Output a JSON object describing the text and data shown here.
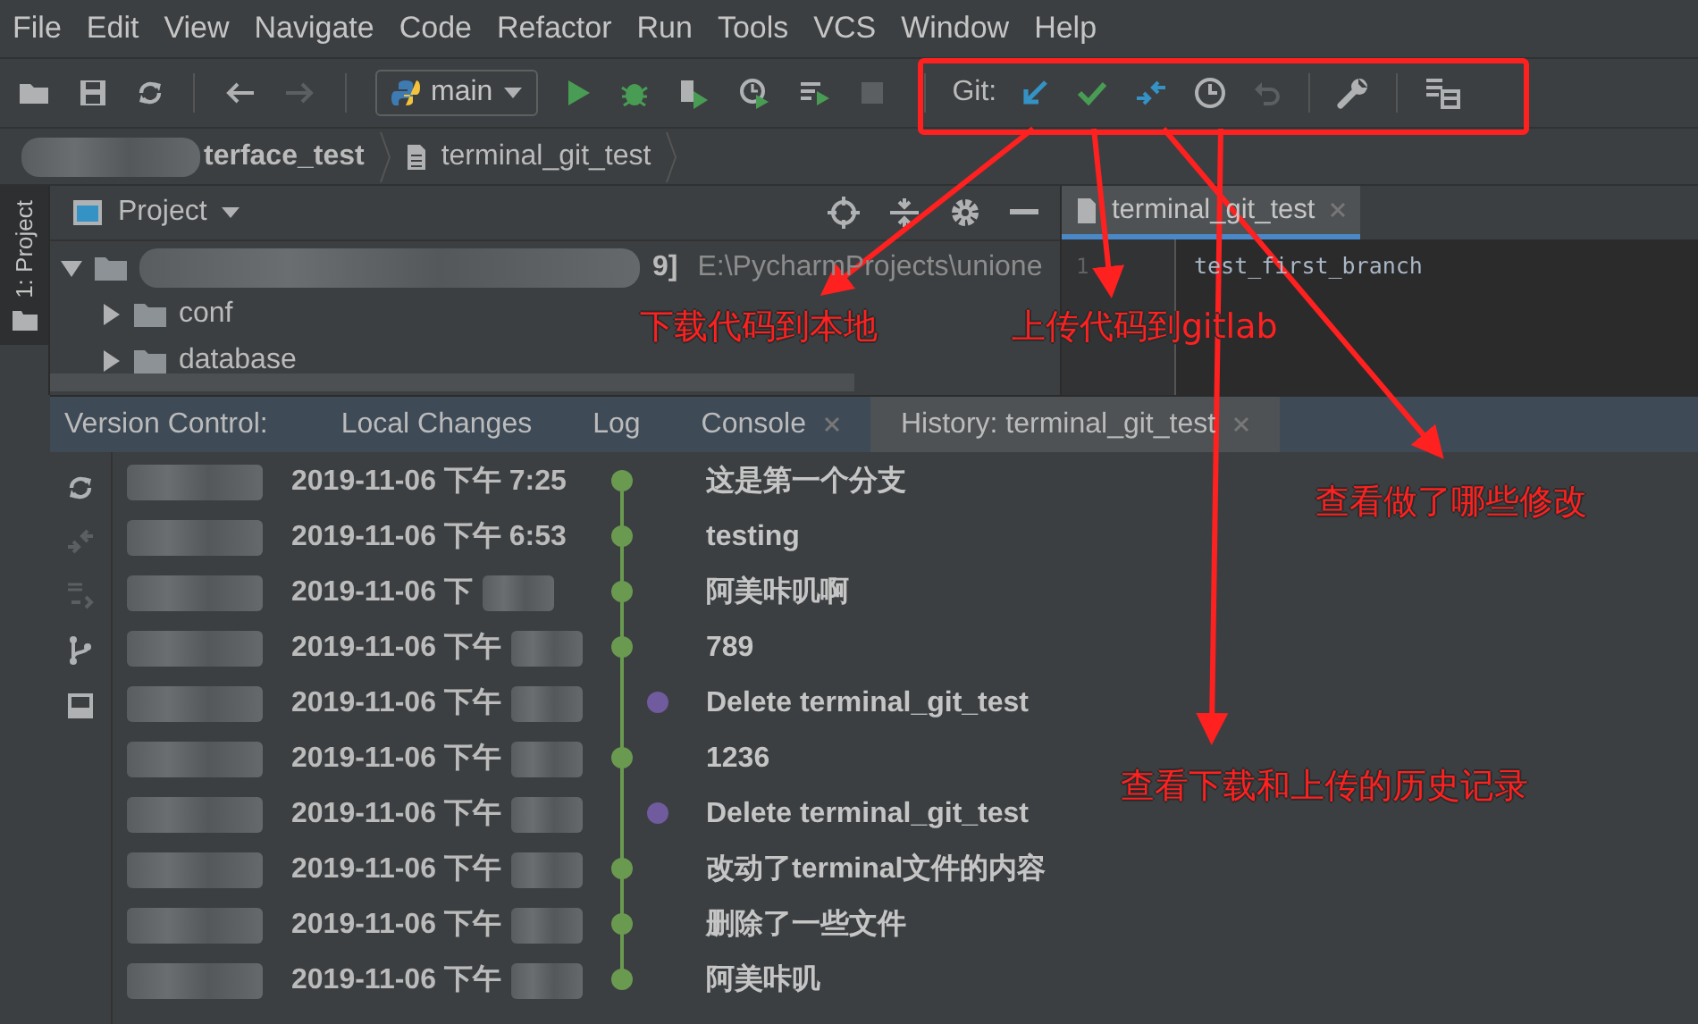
{
  "menu": [
    "File",
    "Edit",
    "View",
    "Navigate",
    "Code",
    "Refactor",
    "Run",
    "Tools",
    "VCS",
    "Window",
    "Help"
  ],
  "toolbar": {
    "run_config": "main",
    "git_label": "Git:"
  },
  "breadcrumbs": [
    "terface_test",
    "terminal_git_test"
  ],
  "side_strip": {
    "label": "1: Project"
  },
  "project_panel": {
    "title": "Project",
    "root": {
      "suffix": "9]",
      "path": "E:\\PycharmProjects\\unione",
      "expanded": true,
      "children": [
        {
          "label": "conf",
          "expanded": false
        },
        {
          "label": "database",
          "expanded": false
        }
      ]
    }
  },
  "editor": {
    "tab": "terminal_git_test",
    "line_number": "1",
    "code": "test_first_branch"
  },
  "version_control": {
    "label": "Version Control:",
    "tabs": [
      {
        "label": "Local Changes",
        "selected": false,
        "closable": false
      },
      {
        "label": "Log",
        "selected": false,
        "closable": false
      },
      {
        "label": "Console",
        "selected": false,
        "closable": true
      },
      {
        "label": "History: terminal_git_test",
        "selected": true,
        "closable": true
      }
    ],
    "commits": [
      {
        "date": "2019-11-06 下午 7:25",
        "message": "这是第一个分支",
        "kind": "main"
      },
      {
        "date": "2019-11-06 下午 6:53",
        "message": "testing",
        "kind": "main"
      },
      {
        "date": "2019-11-06 下",
        "message": "阿美咔叽啊",
        "kind": "main"
      },
      {
        "date": "2019-11-06 下午",
        "message": "789",
        "kind": "main"
      },
      {
        "date": "2019-11-06 下午",
        "message": "Delete terminal_git_test",
        "kind": "branch"
      },
      {
        "date": "2019-11-06 下午",
        "message": "1236",
        "kind": "main"
      },
      {
        "date": "2019-11-06 下午",
        "message": "Delete terminal_git_test",
        "kind": "branch"
      },
      {
        "date": "2019-11-06 下午",
        "message": "改动了terminal文件的内容",
        "kind": "main"
      },
      {
        "date": "2019-11-06 下午",
        "message": "删除了一些文件",
        "kind": "main"
      },
      {
        "date": "2019-11-06 下午",
        "message": "阿美咔叽",
        "kind": "main"
      }
    ]
  },
  "annotations": [
    {
      "text": "下载代码到本地"
    },
    {
      "text": "上传代码到gitlab"
    },
    {
      "text": "查看做了哪些修改"
    },
    {
      "text": "查看下载和上传的历史记录"
    }
  ]
}
